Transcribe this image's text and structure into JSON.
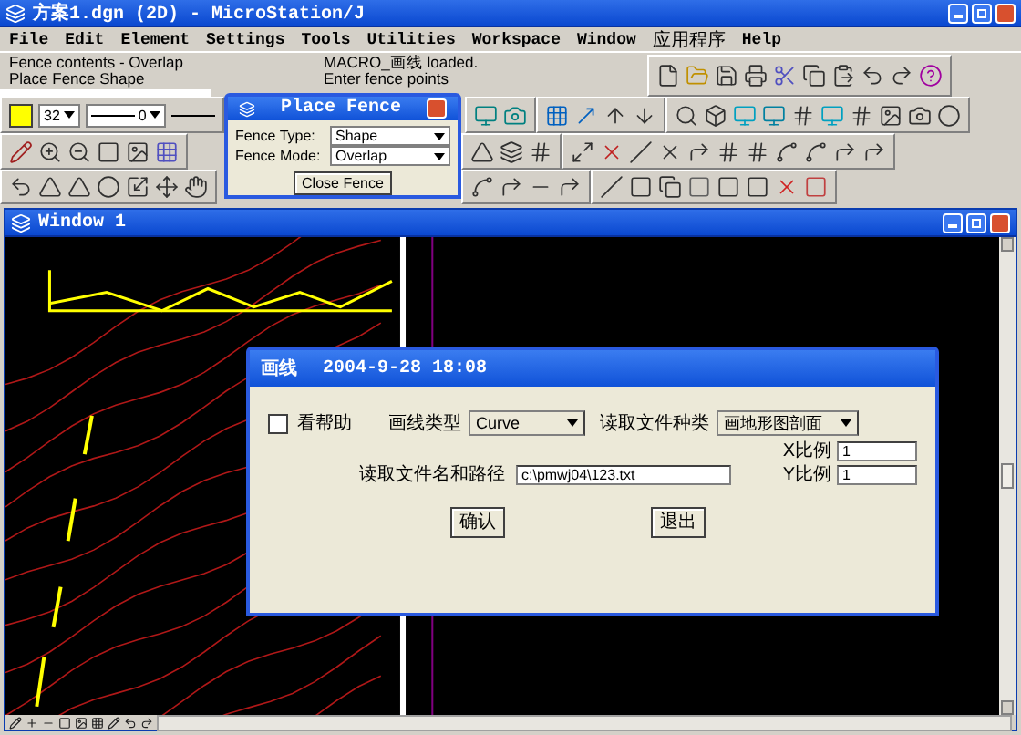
{
  "window": {
    "title": "方案1.dgn (2D) - MicroStation/J"
  },
  "menu": [
    "File",
    "Edit",
    "Element",
    "Settings",
    "Tools",
    "Utilities",
    "Workspace",
    "Window",
    "应用程序",
    "Help"
  ],
  "status": {
    "left": [
      "Fence contents - Overlap",
      "Place Fence Shape"
    ],
    "right": [
      "MACRO_画线 loaded.",
      "Enter fence points"
    ]
  },
  "attributes": {
    "level": "32",
    "weight": "0"
  },
  "place_fence": {
    "title": "Place Fence",
    "fields": [
      {
        "label": "Fence Type:",
        "value": "Shape"
      },
      {
        "label": "Fence Mode:",
        "value": "Overlap"
      }
    ],
    "button": "Close Fence"
  },
  "view_window": {
    "title": "Window 1"
  },
  "draw_dialog": {
    "title": "画线",
    "timestamp": "2004-9-28  18:08",
    "help": {
      "label": "看帮助",
      "checked": false
    },
    "line_type": {
      "label": "画线类型",
      "value": "Curve"
    },
    "file_kind": {
      "label": "读取文件种类",
      "value": "画地形图剖面"
    },
    "path": {
      "label": "读取文件名和路径",
      "value": "c:\\pmwj04\\123.txt"
    },
    "x_scale": {
      "label": "X比例",
      "value": "1"
    },
    "y_scale": {
      "label": "Y比例",
      "value": "1"
    },
    "buttons": [
      "确认",
      "退出"
    ]
  }
}
